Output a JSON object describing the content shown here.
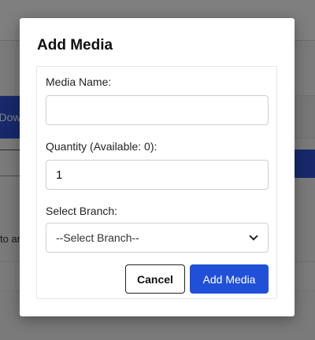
{
  "background": {
    "blue_button_text": "Downto",
    "left_text": "to ar"
  },
  "modal": {
    "title": "Add Media",
    "fields": {
      "media_name": {
        "label": "Media Name:",
        "value": ""
      },
      "quantity": {
        "label": "Quantity (Available: 0):",
        "value": "1"
      },
      "branch": {
        "label": "Select Branch:",
        "selected": "--Select Branch--"
      }
    },
    "buttons": {
      "cancel": "Cancel",
      "add": "Add Media"
    }
  },
  "colors": {
    "primary": "#2150d8",
    "overlay": "rgba(0,0,0,0.5)"
  }
}
